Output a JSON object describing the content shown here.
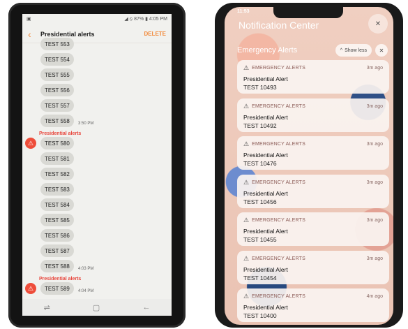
{
  "left_phone": {
    "status": {
      "battery": "87%",
      "time": "4:05 PM"
    },
    "header": {
      "title": "Presidential alerts",
      "delete_label": "DELETE"
    },
    "messages": [
      {
        "text": "TEST 553"
      },
      {
        "text": "TEST 554"
      },
      {
        "text": "TEST 555"
      },
      {
        "text": "TEST 556"
      },
      {
        "text": "TEST 557"
      },
      {
        "text": "TEST 558",
        "time": "3:50 PM"
      },
      {
        "sender": "Presidential alerts"
      },
      {
        "text": "TEST 580",
        "badge": true
      },
      {
        "text": "TEST 581"
      },
      {
        "text": "TEST 582"
      },
      {
        "text": "TEST 583"
      },
      {
        "text": "TEST 584"
      },
      {
        "text": "TEST 585"
      },
      {
        "text": "TEST 586"
      },
      {
        "text": "TEST 587"
      },
      {
        "text": "TEST 588",
        "time": "4:03 PM"
      },
      {
        "sender": "Presidential alerts"
      },
      {
        "text": "TEST 589",
        "badge": true,
        "time": "4:04 PM"
      }
    ]
  },
  "right_phone": {
    "status": {
      "time": "11:53"
    },
    "nc_title": "Notification Center",
    "group": {
      "title": "Emergency Alerts",
      "show_less": "Show less"
    },
    "notifications": [
      {
        "category": "EMERGENCY ALERTS",
        "time": "3m ago",
        "title": "Presidential Alert",
        "body": "TEST 10493"
      },
      {
        "category": "EMERGENCY ALERTS",
        "time": "3m ago",
        "title": "Presidential Alert",
        "body": "TEST 10492"
      },
      {
        "category": "EMERGENCY ALERTS",
        "time": "3m ago",
        "title": "Presidential Alert",
        "body": "TEST 10476"
      },
      {
        "category": "EMERGENCY ALERTS",
        "time": "3m ago",
        "title": "Presidential Alert",
        "body": "TEST 10456"
      },
      {
        "category": "EMERGENCY ALERTS",
        "time": "3m ago",
        "title": "Presidential Alert",
        "body": "TEST 10455"
      },
      {
        "category": "EMERGENCY ALERTS",
        "time": "3m ago",
        "title": "Presidential Alert",
        "body": "TEST 10454"
      },
      {
        "category": "EMERGENCY ALERTS",
        "time": "4m ago",
        "title": "Presidential Alert",
        "body": "TEST 10400"
      }
    ]
  },
  "colors": {
    "accent_orange": "#f28b3c",
    "alert_red": "#ee4d3a"
  }
}
